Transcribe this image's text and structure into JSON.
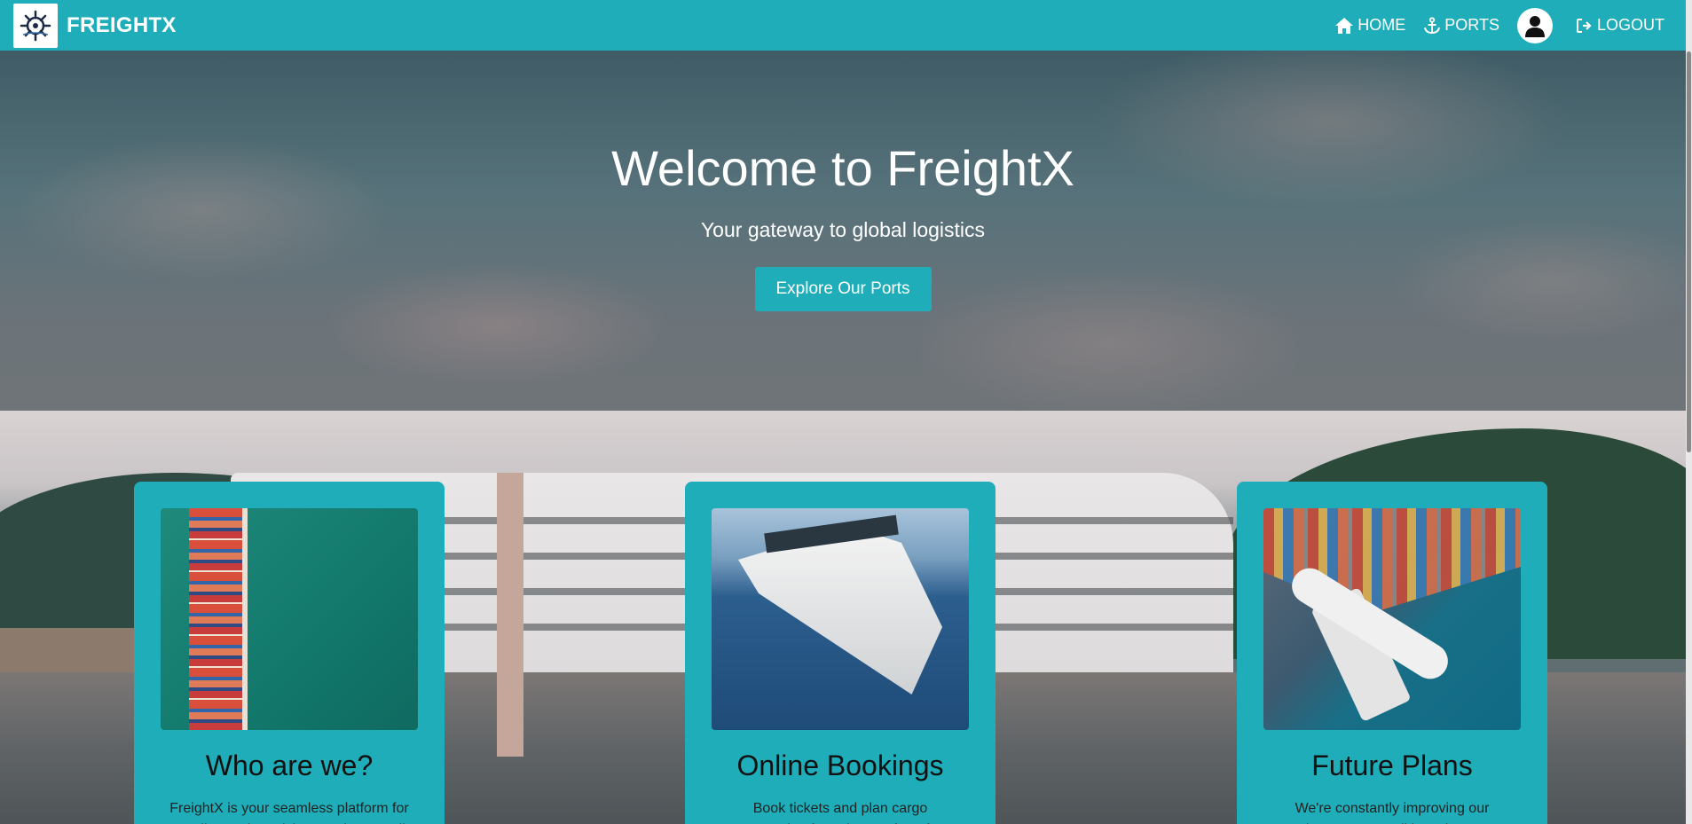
{
  "navbar": {
    "brand_name": "FREIGHTX",
    "logo_icon": "ship-wheel-icon",
    "home_label": "HOME",
    "ports_label": "PORTS",
    "logout_label": "LOGOUT"
  },
  "hero": {
    "title": "Welcome to FreightX",
    "subtitle": "Your gateway to global logistics",
    "cta_label": "Explore Our Ports"
  },
  "cards": [
    {
      "title": "Who are we?",
      "text": "FreightX is your seamless platform for sending and receiving goods, as well as"
    },
    {
      "title": "Online Bookings",
      "text": "Book tickets and plan cargo transportation from the comfort of your"
    },
    {
      "title": "Future Plans",
      "text": "We're constantly improving our services. Soon, we'll launch an aero wing, making"
    }
  ],
  "colors": {
    "primary": "#1eadb9",
    "text_light": "#ffffff",
    "text_dark": "#111111"
  }
}
